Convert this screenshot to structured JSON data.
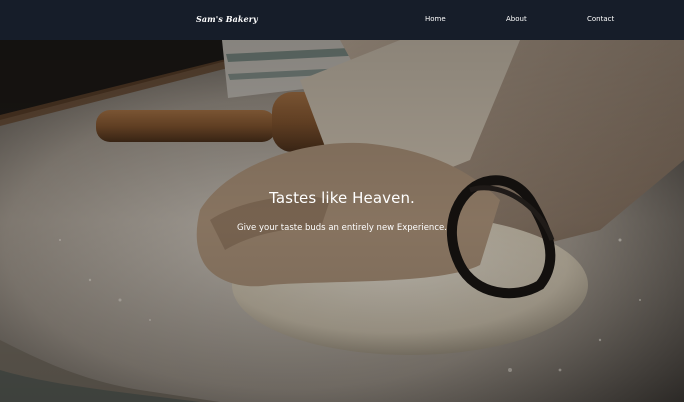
{
  "navbar": {
    "brand": "Sam's Bakery",
    "links": [
      {
        "label": "Home"
      },
      {
        "label": "About"
      },
      {
        "label": "Contact"
      }
    ]
  },
  "hero": {
    "title": "Tastes like Heaven.",
    "subtitle": "Give your taste buds an entirely new Experience."
  },
  "colors": {
    "navbar_background": "#161d29",
    "text": "#ffffff"
  }
}
